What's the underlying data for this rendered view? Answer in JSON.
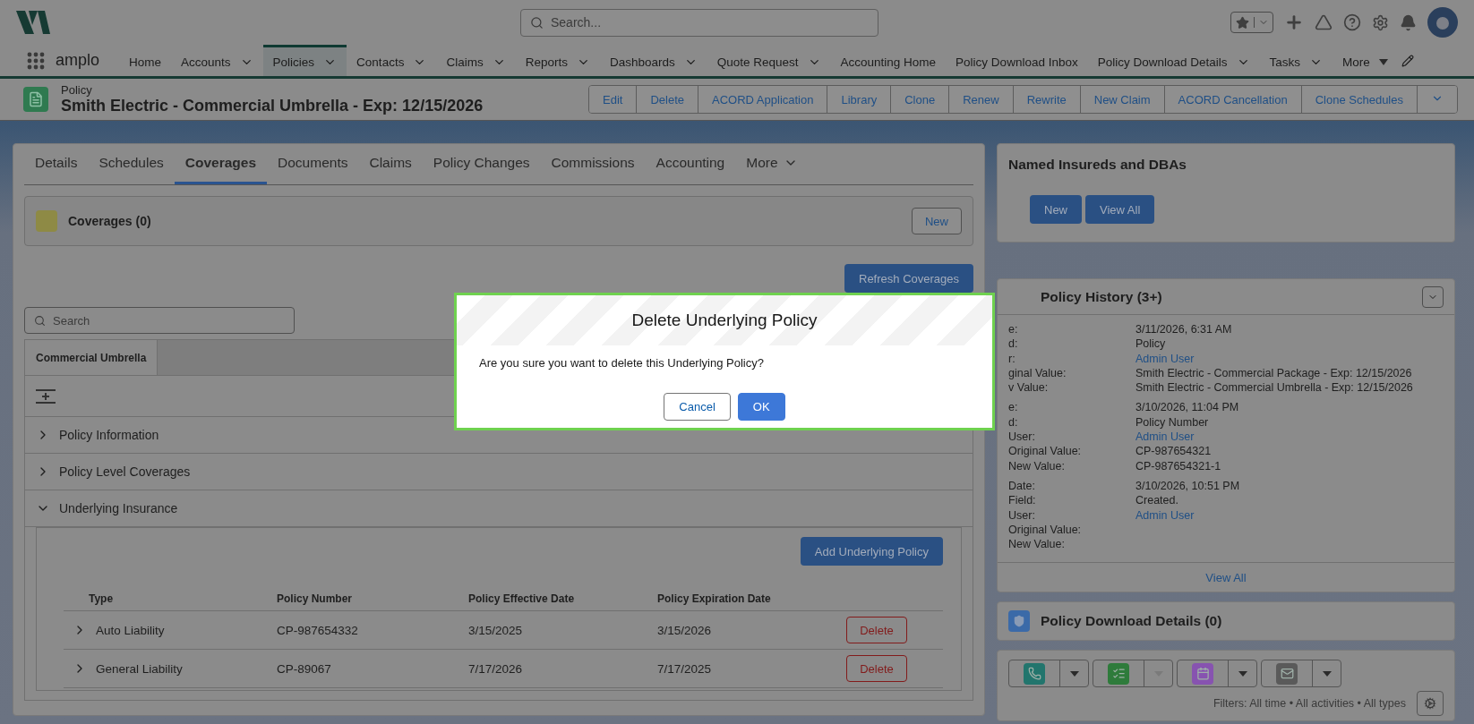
{
  "app": {
    "name": "amplo"
  },
  "search": {
    "placeholder": "Search..."
  },
  "nav": [
    {
      "label": "Home",
      "dropdown": false,
      "selected": false
    },
    {
      "label": "Accounts",
      "dropdown": true,
      "selected": false
    },
    {
      "label": "Policies",
      "dropdown": true,
      "selected": true
    },
    {
      "label": "Contacts",
      "dropdown": true,
      "selected": false
    },
    {
      "label": "Claims",
      "dropdown": true,
      "selected": false
    },
    {
      "label": "Reports",
      "dropdown": true,
      "selected": false
    },
    {
      "label": "Dashboards",
      "dropdown": true,
      "selected": false
    },
    {
      "label": "Quote Request",
      "dropdown": true,
      "selected": false
    },
    {
      "label": "Accounting Home",
      "dropdown": false,
      "selected": false
    },
    {
      "label": "Policy Download Inbox",
      "dropdown": false,
      "selected": false
    },
    {
      "label": "Policy Download Details",
      "dropdown": true,
      "selected": false
    },
    {
      "label": "Tasks",
      "dropdown": true,
      "selected": false
    }
  ],
  "nav_more": "More",
  "record": {
    "type": "Policy",
    "title": "Smith Electric - Commercial Umbrella - Exp: 12/15/2026",
    "actions": [
      "Edit",
      "Delete",
      "ACORD Application",
      "Library",
      "Clone",
      "Renew",
      "Rewrite",
      "New Claim",
      "ACORD Cancellation",
      "Clone Schedules"
    ]
  },
  "tabs": [
    {
      "label": "Details",
      "selected": false
    },
    {
      "label": "Schedules",
      "selected": false
    },
    {
      "label": "Coverages",
      "selected": true
    },
    {
      "label": "Documents",
      "selected": false
    },
    {
      "label": "Claims",
      "selected": false
    },
    {
      "label": "Policy Changes",
      "selected": false
    },
    {
      "label": "Commissions",
      "selected": false
    },
    {
      "label": "Accounting",
      "selected": false
    }
  ],
  "tabs_more": "More",
  "coverages": {
    "title": "Coverages (0)",
    "new_button": "New",
    "refresh_button": "Refresh Coverages",
    "search_placeholder": "Search",
    "subtab": "Commercial Umbrella"
  },
  "sections": [
    {
      "label": "Policy Information",
      "expanded": false
    },
    {
      "label": "Policy Level Coverages",
      "expanded": false
    },
    {
      "label": "Underlying Insurance",
      "expanded": true
    }
  ],
  "underlying": {
    "add_button": "Add Underlying Policy",
    "columns": [
      "Type",
      "Policy Number",
      "Policy Effective Date",
      "Policy Expiration Date"
    ],
    "rows": [
      {
        "type": "Auto Liability",
        "policy_number": "CP-987654332",
        "effective": "3/15/2025",
        "expiration": "3/15/2026",
        "action": "Delete"
      },
      {
        "type": "General Liability",
        "policy_number": "CP-89067",
        "effective": "7/17/2026",
        "expiration": "7/17/2025",
        "action": "Delete"
      }
    ]
  },
  "named_insureds": {
    "title": "Named Insureds and DBAs",
    "buttons": [
      "New",
      "View All"
    ]
  },
  "history": {
    "title": "Policy History (3+)",
    "entries": [
      {
        "fields": [
          {
            "label": "e:",
            "value": "3/11/2026, 6:31 AM",
            "kind": "text"
          },
          {
            "label": "d:",
            "value": "Policy",
            "kind": "text"
          },
          {
            "label": "r:",
            "value": "Admin User",
            "kind": "link"
          },
          {
            "label": "ginal Value:",
            "value": "Smith Electric - Commercial Package - Exp: 12/15/2026",
            "kind": "text"
          },
          {
            "label": "v Value:",
            "value": "Smith Electric - Commercial Umbrella - Exp: 12/15/2026",
            "kind": "text"
          }
        ]
      },
      {
        "fields": [
          {
            "label": "e:",
            "value": "3/10/2026, 11:04 PM",
            "kind": "text"
          },
          {
            "label": "d:",
            "value": "Policy Number",
            "kind": "text"
          },
          {
            "label": "User:",
            "value": "Admin User",
            "kind": "link"
          },
          {
            "label": "Original Value:",
            "value": "CP-987654321",
            "kind": "text"
          },
          {
            "label": "New Value:",
            "value": "CP-987654321-1",
            "kind": "text"
          }
        ]
      },
      {
        "fields": [
          {
            "label": "Date:",
            "value": "3/10/2026, 10:51 PM",
            "kind": "text"
          },
          {
            "label": "Field:",
            "value": "Created.",
            "kind": "text"
          },
          {
            "label": "User:",
            "value": "Admin User",
            "kind": "link"
          },
          {
            "label": "Original Value:",
            "kind": "text"
          },
          {
            "label": "New Value:",
            "kind": "text"
          }
        ]
      }
    ],
    "view_all": "View All"
  },
  "download": {
    "title": "Policy Download Details (0)"
  },
  "activity": {
    "actions": [
      {
        "kind": "call",
        "disabled": false
      },
      {
        "kind": "task",
        "disabled": true
      },
      {
        "kind": "event",
        "disabled": false
      },
      {
        "kind": "email",
        "disabled": false
      }
    ],
    "filters": "Filters: All time • All activities • All types"
  },
  "modal": {
    "title": "Delete Underlying Policy",
    "message": "Are you sure you want to delete this Underlying Policy?",
    "buttons": [
      {
        "label": "Cancel",
        "kind": "neutral"
      },
      {
        "label": "OK",
        "kind": "brand"
      }
    ]
  }
}
